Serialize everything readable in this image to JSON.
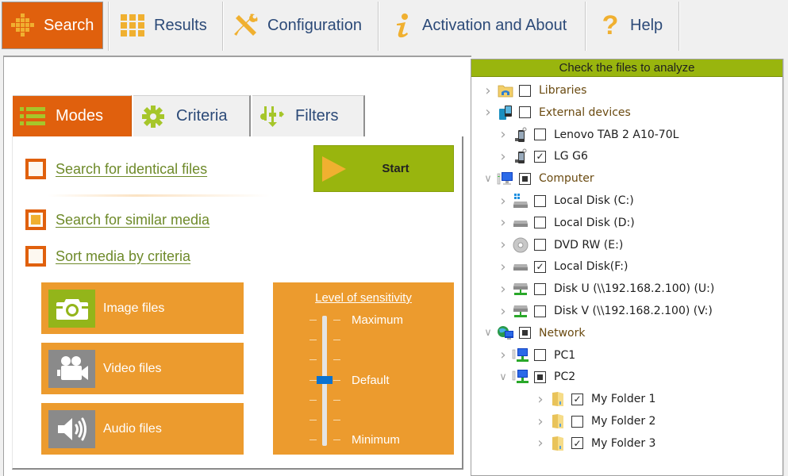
{
  "toolbar": {
    "tabs": [
      {
        "label": "Search",
        "icon": "search-grid-icon",
        "active": true
      },
      {
        "label": "Results",
        "icon": "results-grid-icon",
        "active": false
      },
      {
        "label": "Configuration",
        "icon": "wrench-screwdriver-icon",
        "active": false
      },
      {
        "label": "Activation and About",
        "icon": "info-icon",
        "active": false
      },
      {
        "label": "Help",
        "icon": "question-icon",
        "active": false
      }
    ]
  },
  "subtabs": [
    {
      "label": "Modes",
      "icon": "list-icon",
      "active": true
    },
    {
      "label": "Criteria",
      "icon": "gear-icon",
      "active": false
    },
    {
      "label": "Filters",
      "icon": "filter-icon",
      "active": false
    }
  ],
  "modes": {
    "options": [
      {
        "label": "Search for identical files",
        "checked": false
      },
      {
        "label": "Search for similar media",
        "checked": true
      },
      {
        "label": "Sort media by criteria",
        "checked": false
      }
    ],
    "start_label": "Start",
    "media": [
      {
        "label": "Image files",
        "icon": "camera-icon",
        "active": true
      },
      {
        "label": "Video files",
        "icon": "video-camera-icon",
        "active": false
      },
      {
        "label": "Audio files",
        "icon": "speaker-icon",
        "active": false
      }
    ],
    "sensitivity": {
      "title": "Level of sensitivity",
      "max_label": "Maximum",
      "default_label": "Default",
      "min_label": "Minimum",
      "steps": 7,
      "value_step_from_top": 3
    }
  },
  "colors": {
    "accent_orange": "#e0600d",
    "media_orange": "#ec9b2e",
    "green": "#99b50e",
    "link_green": "#6e8a2a",
    "slider_blue": "#0a72d0"
  },
  "tree": {
    "header": "Check the files to analyze",
    "nodes": [
      {
        "label": "Libraries",
        "level": 0,
        "icon": "libraries-icon",
        "state": "unchecked",
        "expanded": false
      },
      {
        "label": "External devices",
        "level": 0,
        "icon": "external-devices-icon",
        "state": "unchecked",
        "expanded": false
      },
      {
        "label": "Lenovo TAB 2 A10-70L",
        "level": 1,
        "icon": "mobile-device-icon",
        "state": "unchecked",
        "expanded": false
      },
      {
        "label": "LG G6",
        "level": 1,
        "icon": "mobile-device-icon",
        "state": "checked",
        "expanded": false
      },
      {
        "label": "Computer",
        "level": 0,
        "icon": "computer-icon",
        "state": "partial",
        "expanded": true
      },
      {
        "label": "Local Disk (C:)",
        "level": 1,
        "icon": "system-drive-icon",
        "state": "unchecked",
        "expanded": false
      },
      {
        "label": "Local Disk (D:)",
        "level": 1,
        "icon": "drive-icon",
        "state": "unchecked",
        "expanded": false
      },
      {
        "label": "DVD RW (E:)",
        "level": 1,
        "icon": "dvd-icon",
        "state": "unchecked",
        "expanded": false
      },
      {
        "label": "Local Disk(F:)",
        "level": 1,
        "icon": "drive-icon",
        "state": "checked",
        "expanded": false
      },
      {
        "label": "Disk U  (\\\\192.168.2.100) (U:)",
        "level": 1,
        "icon": "network-drive-icon",
        "state": "unchecked",
        "expanded": false
      },
      {
        "label": "Disk V  (\\\\192.168.2.100) (V:)",
        "level": 1,
        "icon": "network-drive-icon",
        "state": "unchecked",
        "expanded": false
      },
      {
        "label": "Network",
        "level": 0,
        "icon": "network-icon",
        "state": "partial",
        "expanded": true
      },
      {
        "label": "PC1",
        "level": 1,
        "icon": "network-computer-icon",
        "state": "unchecked",
        "expanded": false
      },
      {
        "label": "PC2",
        "level": 1,
        "icon": "network-computer-icon",
        "state": "partial",
        "expanded": true
      },
      {
        "label": "My Folder 1",
        "level": 2,
        "icon": "folder-icon",
        "state": "checked",
        "expanded": false
      },
      {
        "label": "My Folder 2",
        "level": 2,
        "icon": "folder-icon",
        "state": "unchecked",
        "expanded": false
      },
      {
        "label": "My Folder 3",
        "level": 2,
        "icon": "folder-icon",
        "state": "checked",
        "expanded": false
      }
    ]
  }
}
